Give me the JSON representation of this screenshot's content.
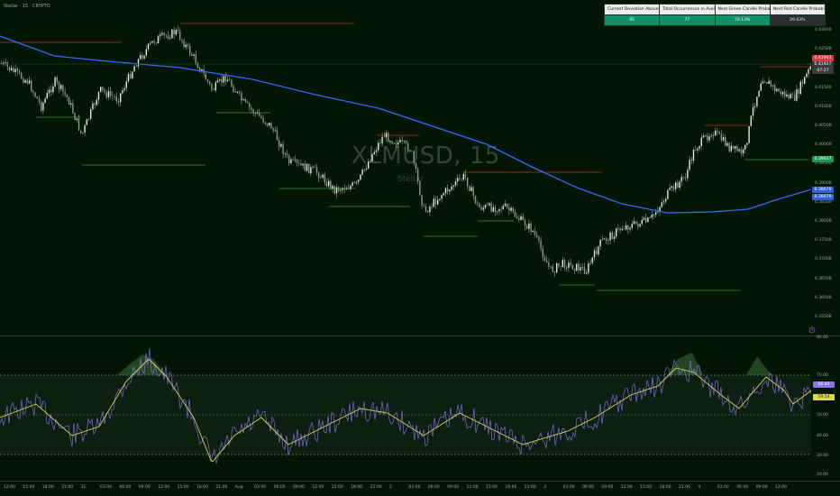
{
  "header": {
    "title": "Stellar · 15 · CRYPTO"
  },
  "price_axis": {
    "currency": "USD",
    "ticks": [
      "0.43000",
      "0.42500",
      "0.42000",
      "0.41500",
      "0.41000",
      "0.40500",
      "0.40000",
      "0.39500",
      "0.39000",
      "0.38500",
      "0.38000",
      "0.37500",
      "0.37000",
      "0.36500",
      "0.36000",
      "0.35500"
    ],
    "badges": [
      {
        "value": "0.41943",
        "color": "#e2363f"
      },
      {
        "value": "0.41927",
        "color": "#3a3a3a"
      },
      {
        "value": "07:27",
        "color": "#3a3a3a"
      },
      {
        "value": "0.39617",
        "color": "#1a9a55"
      },
      {
        "value": "0.38679",
        "color": "#2b63e0"
      },
      {
        "value": "0.38679",
        "color": "#2b63e0"
      }
    ]
  },
  "watermark": {
    "symbol": "XLMUSD, 15",
    "name": "Stellar"
  },
  "stats_table": {
    "headers": [
      "Current Deviation Above SMA 200",
      "Total Occurrences in Available History",
      "Next Green Candle Probability",
      "Next Red Candle Probability"
    ],
    "values": [
      "95",
      "77",
      "70.13%",
      "29.63%"
    ]
  },
  "oscillator_axis": {
    "ticks": [
      "90.00",
      "70.00",
      "60.00",
      "50.00",
      "40.00",
      "30.00",
      "20.00"
    ],
    "badges": [
      {
        "value": "66.40",
        "color": "#8c72e8"
      },
      {
        "value": "59.54",
        "color": "#e2d94a"
      }
    ]
  },
  "time_axis": {
    "labels": [
      "12:00",
      "15:00",
      "18:00",
      "21:00",
      "31",
      "03:00",
      "06:00",
      "09:00",
      "12:00",
      "15:00",
      "18:00",
      "21:00",
      "Aug",
      "03:00",
      "06:00",
      "09:00",
      "12:00",
      "15:00",
      "18:00",
      "21:00",
      "2",
      "03:00",
      "06:00",
      "09:00",
      "12:00",
      "15:00",
      "18:00",
      "21:00",
      "3",
      "03:00",
      "06:00",
      "09:00",
      "12:00",
      "15:00",
      "18:00",
      "21:00",
      "4",
      "03:00",
      "06:00",
      "09:00",
      "12:00"
    ]
  },
  "colors": {
    "background": "#031503",
    "sma_line": "#2f6bff",
    "candle": "#dfe9df",
    "resistance": "#b72e2e",
    "support": "#3f8a4d",
    "rsi_line": "#7a6cd6",
    "rsi_ma": "#d6d24a"
  },
  "icons": {
    "alert": "alert-clock-icon"
  }
}
